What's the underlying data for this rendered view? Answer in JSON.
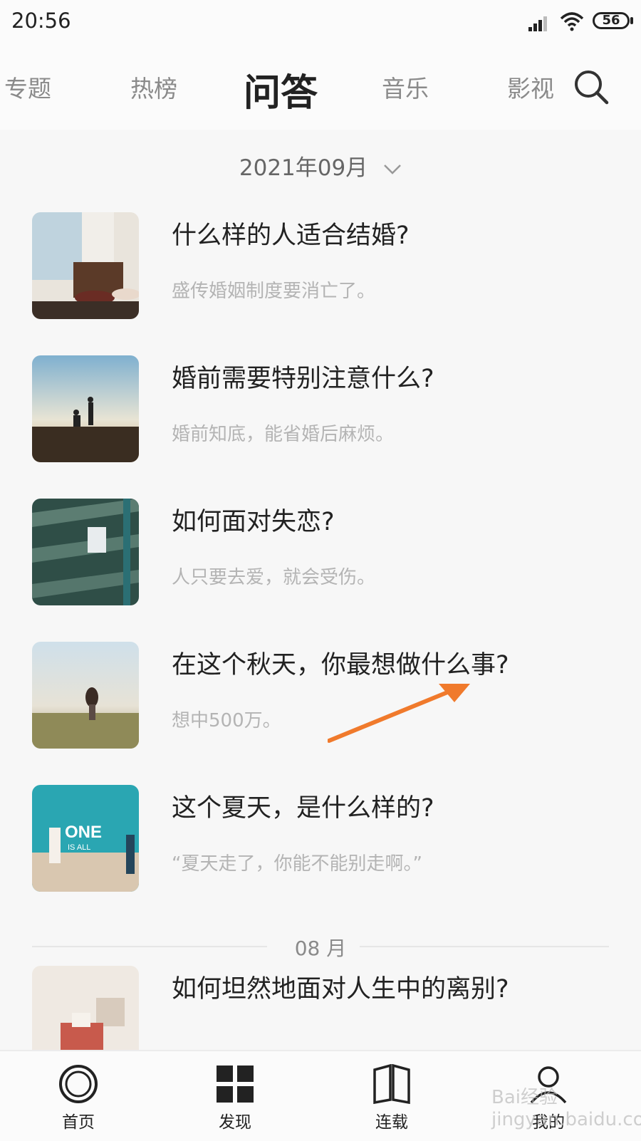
{
  "status": {
    "time": "20:56",
    "battery": "56"
  },
  "nav": {
    "tabs": [
      "专题",
      "热榜",
      "问答",
      "音乐",
      "影视"
    ],
    "active": "问答"
  },
  "month_picker": {
    "label": "2021年09月"
  },
  "items": [
    {
      "title": "什么样的人适合结婚?",
      "subtitle": "盛传婚姻制度要消亡了。"
    },
    {
      "title": "婚前需要特别注意什么?",
      "subtitle": "婚前知底，能省婚后麻烦。"
    },
    {
      "title": "如何面对失恋?",
      "subtitle": "人只要去爱，就会受伤。"
    },
    {
      "title": "在这个秋天，你最想做什么事?",
      "subtitle": "想中500万。"
    },
    {
      "title": "这个夏天，是什么样的?",
      "subtitle": "“夏天走了，你能不能别走啊。”",
      "thumb_text": "ONE",
      "thumb_subtext": "IS ALL"
    },
    {
      "title": "如何坦然地面对人生中的离别?"
    }
  ],
  "section_divider": "08 月",
  "bottom_nav": [
    "首页",
    "发现",
    "连载",
    "我的"
  ],
  "watermark": "Bai经验 jingyan.baidu.com",
  "colors": {
    "accent_arrow": "#f07a2c",
    "text_primary": "#222222",
    "text_secondary": "#b4b4b4"
  }
}
